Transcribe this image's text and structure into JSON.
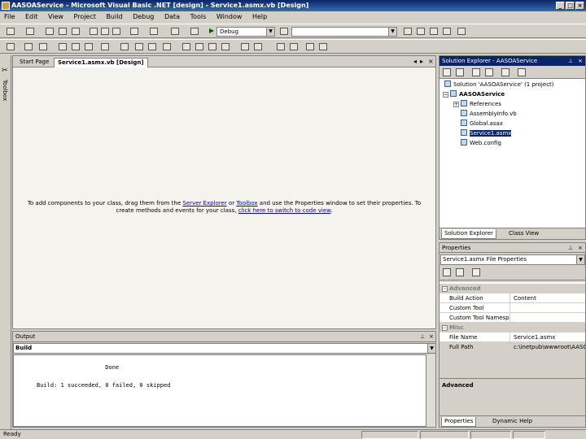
{
  "window": {
    "title": "AASOAService - Microsoft Visual Basic .NET [design] - Service1.asmx.vb [Design]"
  },
  "menu": [
    "File",
    "Edit",
    "View",
    "Project",
    "Build",
    "Debug",
    "Data",
    "Tools",
    "Window",
    "Help"
  ],
  "toolbar": {
    "config_combo": "Debug",
    "find_combo": ""
  },
  "toolbox": {
    "label": "Toolbox"
  },
  "document": {
    "tabs": [
      "Start Page",
      "Service1.asmx.vb [Design]"
    ],
    "message_prefix": "To add components to your class, drag them from the ",
    "link_server_explorer": "Server Explorer",
    "message_or": " or ",
    "link_toolbox": "Toolbox",
    "message_mid": " and use the Properties window to set their properties. To create methods and events for your class, ",
    "link_code_view": "click here to switch to code view",
    "message_end": "."
  },
  "output": {
    "title": "Output",
    "combo": "Build",
    "lines": "                    Done\n\nBuild: 1 succeeded, 0 failed, 0 skipped"
  },
  "solution_explorer": {
    "title": "Solution Explorer - AASOAService",
    "items": [
      "Solution 'AASOAService' (1 project)",
      "AASOAService",
      "References",
      "AssemblyInfo.vb",
      "Global.asax",
      "Service1.asmx",
      "Web.config"
    ],
    "tabs": [
      "Solution Explorer",
      "Class View"
    ]
  },
  "properties": {
    "title": "Properties",
    "combo": "Service1.asmx  File Properties",
    "categories": [
      "Advanced",
      "Misc"
    ],
    "rows": [
      {
        "name": "Build Action",
        "value": "Content"
      },
      {
        "name": "Custom Tool",
        "value": ""
      },
      {
        "name": "Custom Tool Namespace",
        "value": ""
      },
      {
        "name": "File Name",
        "value": "Service1.asmx"
      },
      {
        "name": "Full Path",
        "value": "c:\\inetpub\\wwwroot\\AASOA"
      }
    ],
    "description": "Advanced",
    "tabs": [
      "Properties",
      "Dynamic Help"
    ]
  },
  "status": {
    "text": "Ready"
  }
}
